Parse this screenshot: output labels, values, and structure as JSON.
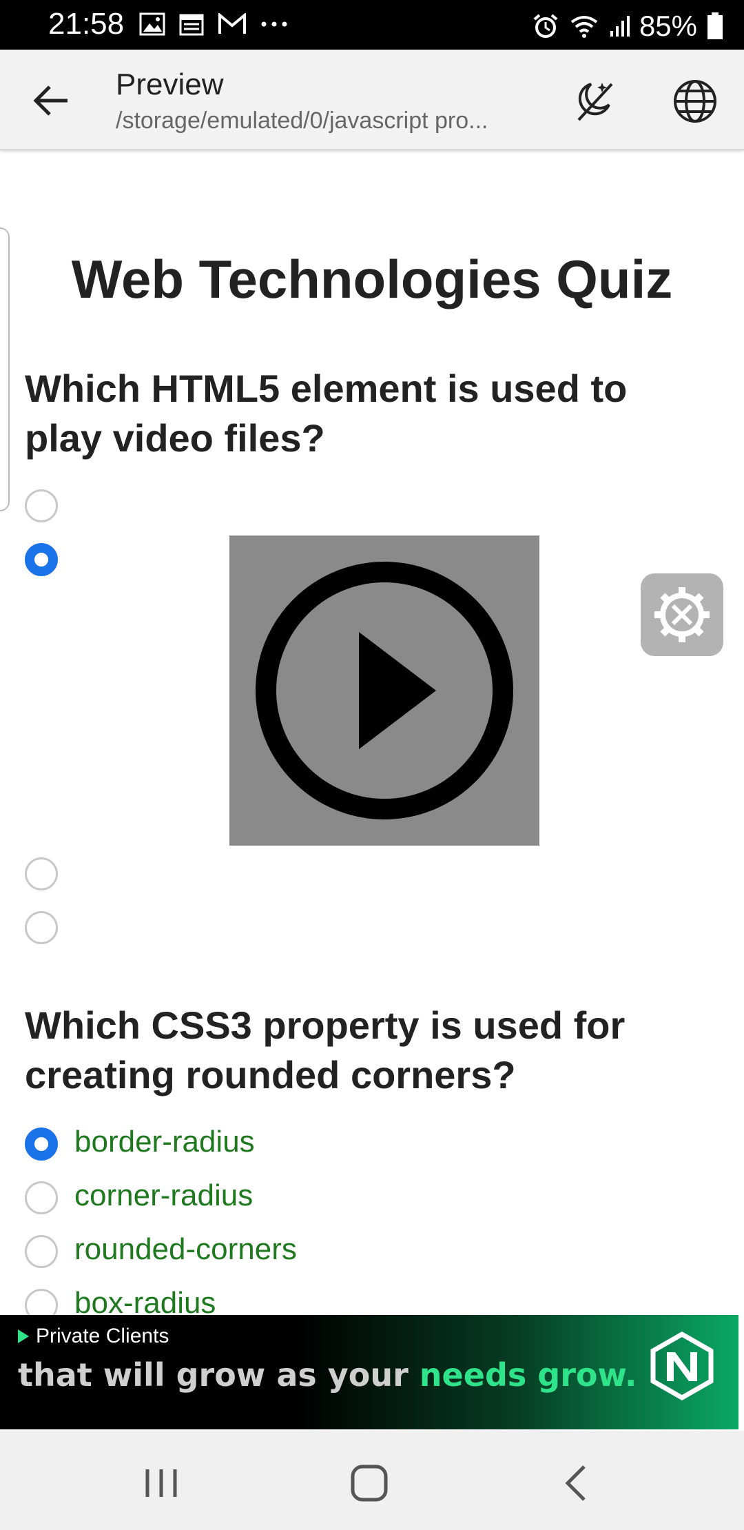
{
  "status_bar": {
    "time": "21:58",
    "battery": "85%",
    "left_icons": [
      "gallery-icon",
      "calendar-icon",
      "gmail-icon",
      "more-dots-icon"
    ],
    "right_icons": [
      "alarm-icon",
      "wifi-icon",
      "signal-icon",
      "battery-icon"
    ]
  },
  "app_bar": {
    "title": "Preview",
    "subtitle": "/storage/emulated/0/javascript pro...",
    "back_icon": "arrow-left-icon",
    "night_icon": "night-mode-icon",
    "globe_icon": "globe-icon"
  },
  "quiz": {
    "title": "Web Technologies Quiz",
    "q1": {
      "text_line1": "Which HTML5 element is used to",
      "text_line2": "play video files?",
      "selected_index": 1
    },
    "q2": {
      "text_line1": "Which CSS3 property is used for",
      "text_line2": "creating rounded corners?",
      "options": [
        "border-radius",
        "corner-radius",
        "rounded-corners",
        "box-radius"
      ],
      "selected_index": 0
    }
  },
  "ad": {
    "label": "Private Clients",
    "text_plain": "that will grow as your ",
    "text_highlight": "needs grow."
  },
  "colors": {
    "radio_checked": "#1a73e8",
    "option_text": "#1f7a1f",
    "ad_highlight": "#2ee38a"
  },
  "nav_bar": {
    "buttons": [
      "recent-apps-icon",
      "home-icon",
      "back-icon"
    ]
  }
}
